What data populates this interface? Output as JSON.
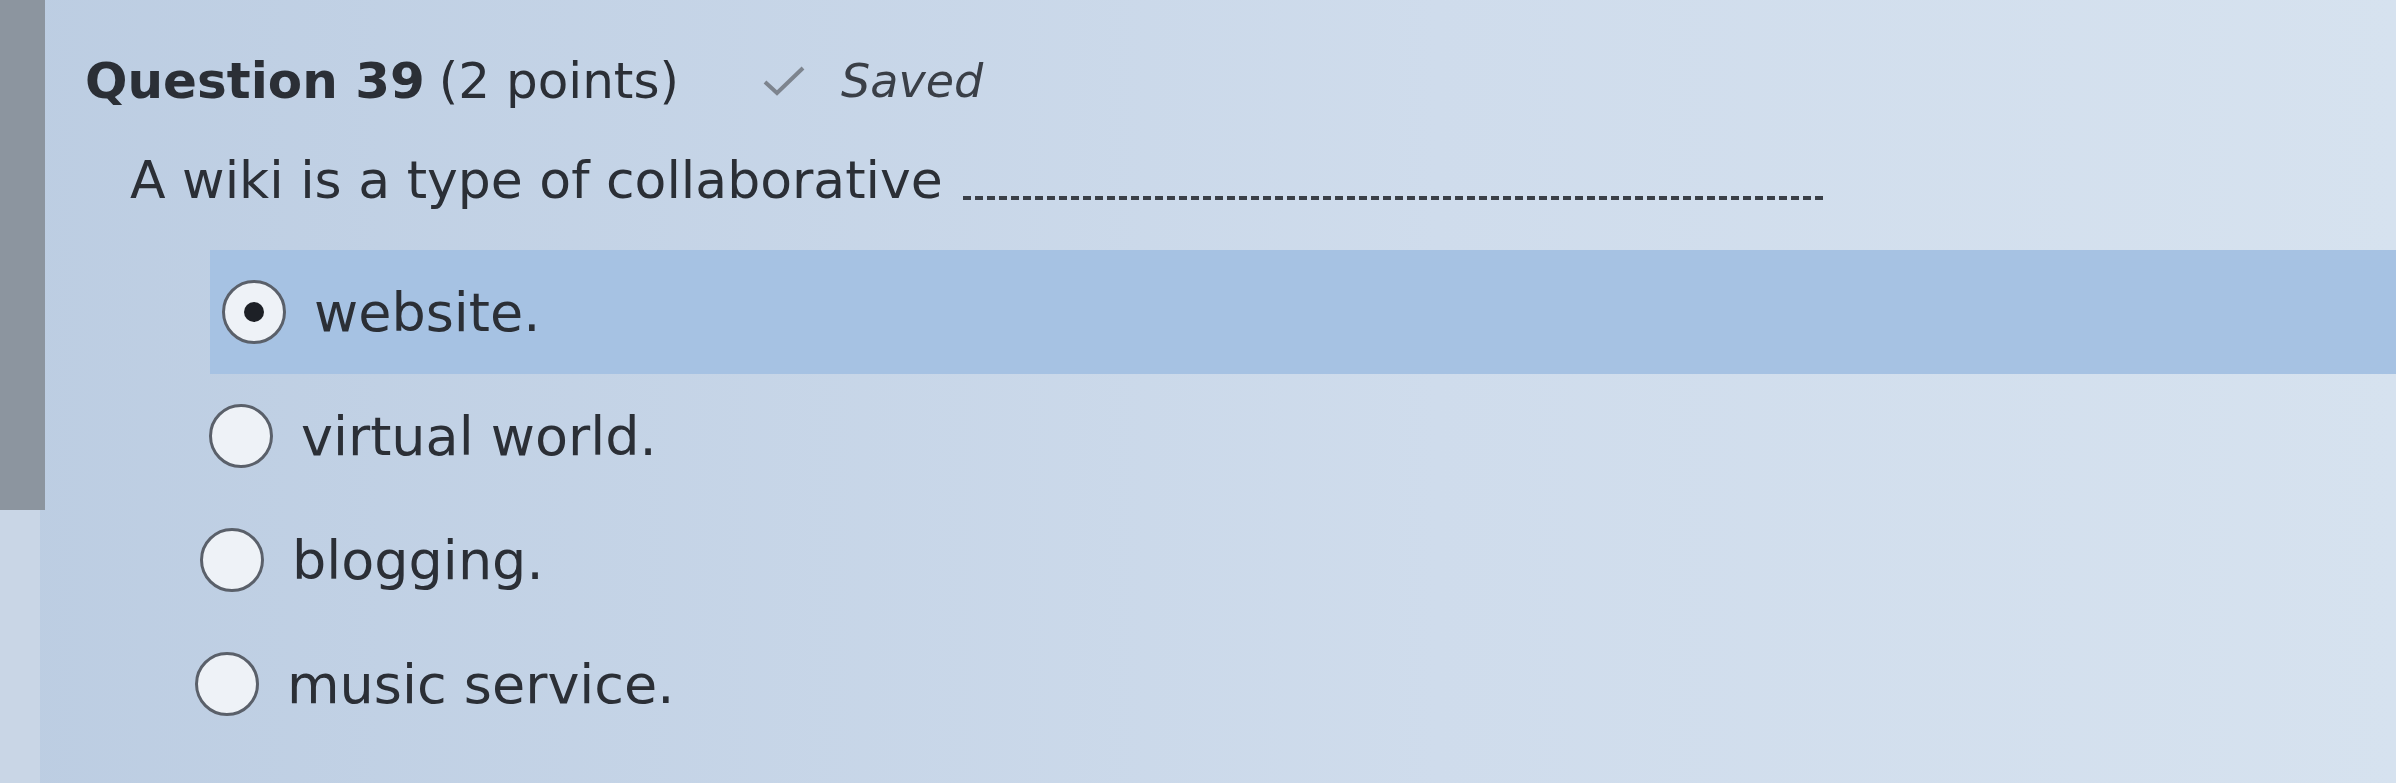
{
  "question": {
    "title": "Question 39",
    "points": "(2 points)",
    "saved": true,
    "status": "Saved"
  },
  "prompt": {
    "text": "A wiki is a type of collaborative",
    "blank": true
  },
  "options": [
    {
      "label": "website.",
      "selected": true
    },
    {
      "label": "virtual world.",
      "selected": false
    },
    {
      "label": "blogging.",
      "selected": false
    },
    {
      "label": "music service.",
      "selected": false
    }
  ]
}
